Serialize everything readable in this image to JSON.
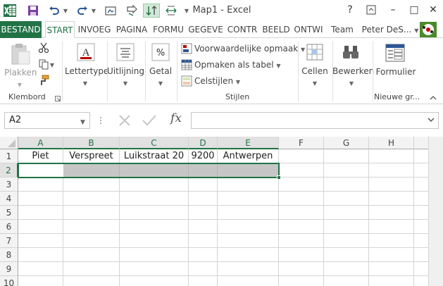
{
  "app": {
    "title": "Map1 - Excel"
  },
  "window_controls": {
    "help": "?",
    "minimize": "–",
    "restore": "□",
    "close": "✕"
  },
  "tabs": [
    {
      "label": "BESTAND"
    },
    {
      "label": "START"
    },
    {
      "label": "INVOEG"
    },
    {
      "label": "PAGINA"
    },
    {
      "label": "FORMU"
    },
    {
      "label": "GEGEVE"
    },
    {
      "label": "CONTR"
    },
    {
      "label": "BEELD"
    },
    {
      "label": "ONTWI"
    },
    {
      "label": "Team"
    }
  ],
  "user": {
    "name": "Peter DeS..."
  },
  "ribbon": {
    "clipboard": {
      "paste_label": "Plakken",
      "group_label": "Klembord"
    },
    "font_label": "Lettertype",
    "alignment_label": "Uitlijning",
    "number_label": "Getal",
    "styles": {
      "conditional": "Voorwaardelijke opmaak",
      "format_table": "Opmaken als tabel",
      "cell_styles": "Celstijlen",
      "group_label": "Stijlen"
    },
    "cells_label": "Cellen",
    "editing_label": "Bewerken",
    "form_label": "Formulier",
    "new_group_label": "Nieuwe gr..."
  },
  "formula_bar": {
    "name_box": "A2",
    "fx": "fx",
    "value": ""
  },
  "sheet": {
    "columns": [
      "A",
      "B",
      "C",
      "D",
      "E",
      "F",
      "G",
      "H"
    ],
    "rows": [
      "1",
      "2",
      "3",
      "4",
      "5",
      "6",
      "7",
      "8",
      "9",
      "10"
    ],
    "row1": [
      "Piet",
      "Verspreet",
      "Luikstraat 20",
      "9200",
      "Antwerpen"
    ]
  },
  "colors": {
    "accent": "#217346"
  }
}
